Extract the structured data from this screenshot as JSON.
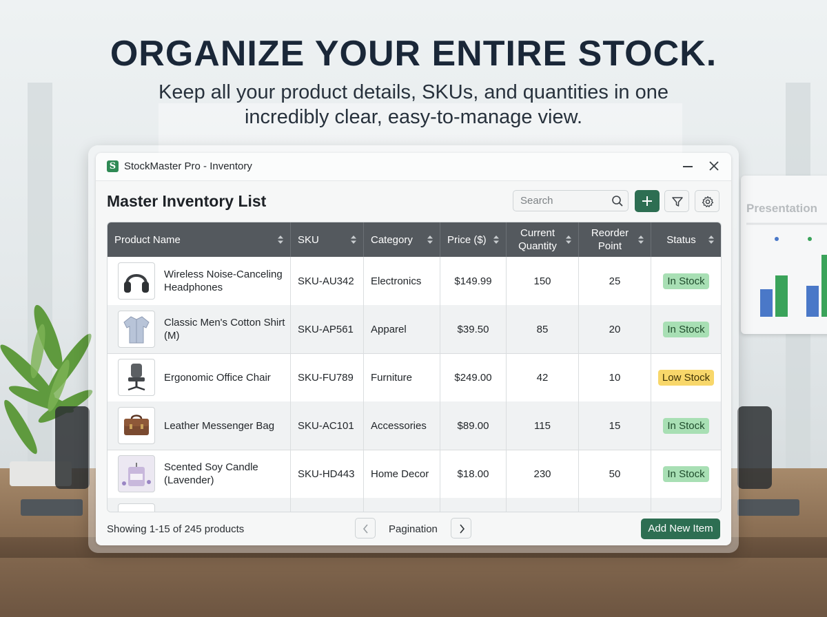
{
  "hero": {
    "headline": "ORGANIZE YOUR ENTIRE STOCK.",
    "subhead": "Keep all your product details, SKUs, and quantities in one incredibly clear, easy-to-manage view."
  },
  "background": {
    "board_title": "Presentation"
  },
  "window": {
    "logo_letter": "S",
    "title": "StockMaster Pro - Inventory",
    "minimize_icon": "minimize-icon",
    "close_icon": "close-icon"
  },
  "toolbar": {
    "list_title": "Master Inventory List",
    "search_placeholder": "Search",
    "add_icon": "plus-icon",
    "filter_icon": "filter-icon",
    "settings_icon": "gear-icon"
  },
  "table": {
    "columns": [
      {
        "label": "Product Name"
      },
      {
        "label": "SKU"
      },
      {
        "label": "Category"
      },
      {
        "label": "Price ($)"
      },
      {
        "label": "Current Quantity"
      },
      {
        "label": "Reorder Point"
      },
      {
        "label": "Status"
      }
    ],
    "rows": [
      {
        "name": "Wireless Noise-Canceling Headphones",
        "sku": "SKU-AU342",
        "category": "Electronics",
        "price": "$149.99",
        "qty": "150",
        "reorder": "25",
        "status": "In Stock",
        "status_type": "in",
        "thumb_icon": "headphones-icon"
      },
      {
        "name": "Classic Men's Cotton Shirt (M)",
        "sku": "SKU-AP561",
        "category": "Apparel",
        "price": "$39.50",
        "qty": "85",
        "reorder": "20",
        "status": "In Stock",
        "status_type": "in",
        "thumb_icon": "shirt-icon"
      },
      {
        "name": "Ergonomic Office Chair",
        "sku": "SKU-FU789",
        "category": "Furniture",
        "price": "$249.00",
        "qty": "42",
        "reorder": "10",
        "status": "Low Stock",
        "status_type": "low",
        "thumb_icon": "office-chair-icon"
      },
      {
        "name": "Leather Messenger Bag",
        "sku": "SKU-AC101",
        "category": "Accessories",
        "price": "$89.00",
        "qty": "115",
        "reorder": "15",
        "status": "In Stock",
        "status_type": "in",
        "thumb_icon": "messenger-bag-icon"
      },
      {
        "name": "Scented Soy Candle (Lavender)",
        "sku": "SKU-HD443",
        "category": "Home Decor",
        "price": "$18.00",
        "qty": "230",
        "reorder": "50",
        "status": "In Stock",
        "status_type": "in",
        "thumb_icon": "candle-icon"
      }
    ]
  },
  "footer": {
    "showing": "Showing 1-15 of 245 products",
    "pagination_label": "Pagination",
    "add_new_label": "Add New Item"
  },
  "colors": {
    "accent": "#2d6e52",
    "header_bg": "#54595e",
    "in_stock": "#a8dfb4",
    "low_stock": "#f8d76a"
  }
}
